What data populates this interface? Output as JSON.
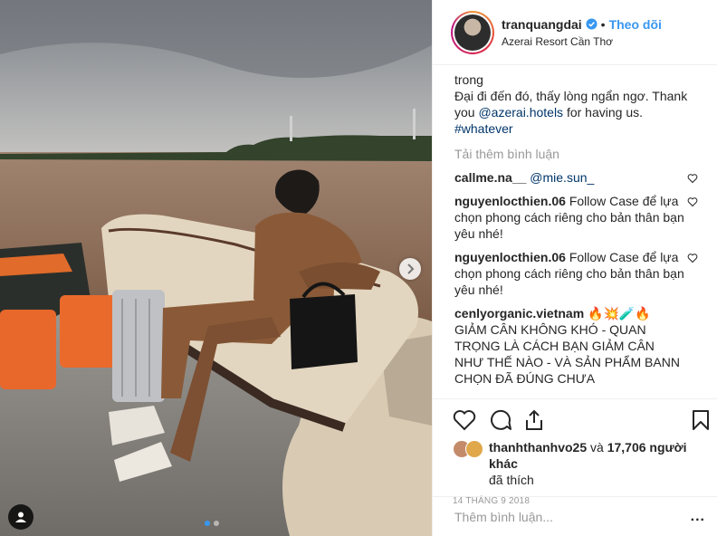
{
  "post": {
    "username": "tranquangdai",
    "separator": "•",
    "follow_label": "Theo dõi",
    "location": "Azerai Resort Cần Thơ",
    "caption_line1": "trong",
    "caption_line2_pre": "Đại đi đến đó, thấy lòng ngẩn ngơ. Thank you ",
    "caption_mention": "@azerai.hotels",
    "caption_line2_post": " for having us.",
    "caption_hashtag": "#whatever",
    "load_more_label": "Tải thêm bình luận"
  },
  "comments": [
    {
      "user": "callme.na__",
      "text": "",
      "mention": "@mie.sun_"
    },
    {
      "user": "nguyenlocthien.06",
      "text": "Follow Case để lựa chọn phong cách riêng cho bản thân bạn yêu nhé!"
    },
    {
      "user": "nguyenlocthien.06",
      "text": "Follow Case để lựa chọn phong cách riêng cho bản thân bạn yêu nhé!"
    },
    {
      "user": "cenlyorganic.vietnam",
      "text": "🔥💥🧪🔥 GIẢM CÂN KHÔNG KHÓ - QUAN TRỌNG LÀ CÁCH BẠN GIẢM CÂN NHƯ THẾ NÀO - VÀ SẢN PHẨM BANN CHỌN ĐÃ ĐÚNG CHƯA"
    }
  ],
  "likes": {
    "liker": "thanhthanhvo25",
    "connector": " và ",
    "count_text": "17,706 người khác",
    "suffix": "đã thích"
  },
  "timestamp": "14 THÁNG 9 2018",
  "add_comment_placeholder": "Thêm bình luận...",
  "more_label": "...",
  "icons": {
    "like": "heart-icon",
    "comment": "comment-icon",
    "share": "share-icon",
    "save": "bookmark-icon",
    "verified": "verified-badge-icon",
    "next": "chevron-right-icon",
    "tags": "user-tag-icon"
  },
  "colors": {
    "accent": "#3897f0",
    "mention": "#003569",
    "muted": "#999999"
  },
  "carousel": {
    "count": 2,
    "active_index": 0
  }
}
